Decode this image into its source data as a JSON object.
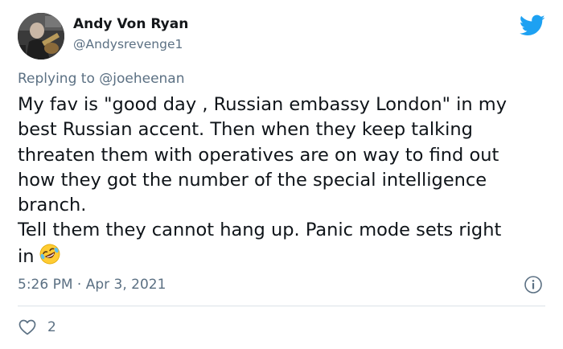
{
  "tweet": {
    "display_name": "Andy Von Ryan",
    "handle": "@Andysrevenge1",
    "replying_label": "Replying to",
    "replying_to": "@joeheenan",
    "body_lines": [
      "My fav is \"good day , Russian embassy London\" in my",
      "best Russian accent. Then when they keep talking",
      "threaten them with operatives are on way to find out",
      "how they got the number of the special intelligence",
      "branch.",
      "Tell them they cannot hang up. Panic mode sets right",
      "in"
    ],
    "timestamp": "5:26 PM · Apr 3, 2021",
    "like_count": "2"
  },
  "icons": {
    "avatar": "avatar",
    "brand": "twitter-bird-icon",
    "emoji": "rolling-on-floor-laughing-emoji",
    "info": "info-icon",
    "like": "heart-icon"
  },
  "colors": {
    "brand": "#1da1f2",
    "secondary_text": "#5b7083",
    "primary_text": "#0f1419",
    "divider": "#dbe2e7"
  }
}
